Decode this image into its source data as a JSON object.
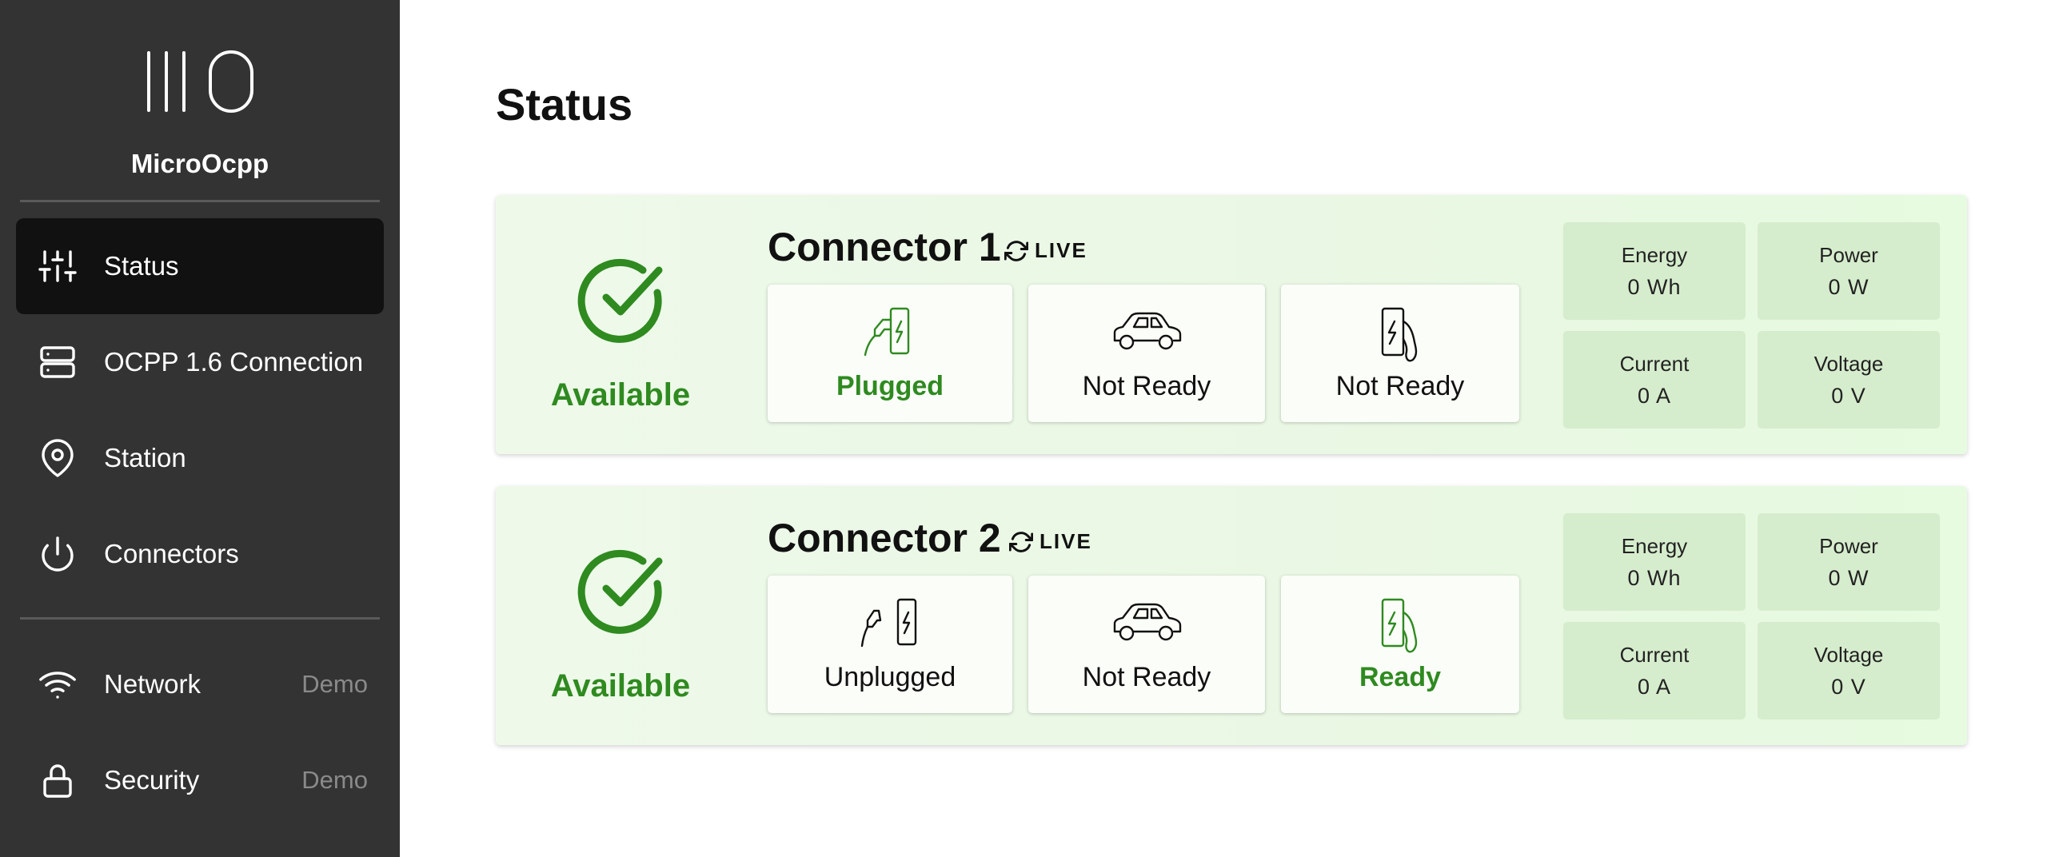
{
  "app": {
    "brand": "MicroOcpp",
    "logo_icon": "microocpp-logo"
  },
  "sidebar": {
    "items": [
      {
        "label": "Status",
        "icon": "sliders-icon",
        "badge": "",
        "active": true
      },
      {
        "label": "OCPP 1.6 Connection",
        "icon": "server-icon",
        "badge": ""
      },
      {
        "label": "Station",
        "icon": "map-pin-icon",
        "badge": ""
      },
      {
        "label": "Connectors",
        "icon": "power-icon",
        "badge": ""
      },
      {
        "label": "Network",
        "icon": "wifi-icon",
        "badge": "Demo"
      },
      {
        "label": "Security",
        "icon": "lock-icon",
        "badge": "Demo"
      }
    ]
  },
  "page": {
    "title": "Status"
  },
  "connectors": [
    {
      "title": "Connector 1",
      "live": "LIVE",
      "status": "Available",
      "tiles": [
        {
          "label": "Plugged",
          "icon": "plug-connected-icon",
          "active": true
        },
        {
          "label": "Not Ready",
          "icon": "car-icon",
          "active": false
        },
        {
          "label": "Not Ready",
          "icon": "charger-icon",
          "active": false
        }
      ],
      "metrics": [
        {
          "name": "Energy",
          "value": "0 Wh"
        },
        {
          "name": "Power",
          "value": "0 W"
        },
        {
          "name": "Current",
          "value": "0 A"
        },
        {
          "name": "Voltage",
          "value": "0 V"
        }
      ]
    },
    {
      "title": "Connector 2",
      "live": "LIVE",
      "status": "Available",
      "tiles": [
        {
          "label": "Unplugged",
          "icon": "plug-disconnected-icon",
          "active": false
        },
        {
          "label": "Not Ready",
          "icon": "car-icon",
          "active": false
        },
        {
          "label": "Ready",
          "icon": "charger-icon",
          "active": true
        }
      ],
      "metrics": [
        {
          "name": "Energy",
          "value": "0 Wh"
        },
        {
          "name": "Power",
          "value": "0 W"
        },
        {
          "name": "Current",
          "value": "0 A"
        },
        {
          "name": "Voltage",
          "value": "0 V"
        }
      ]
    }
  ],
  "colors": {
    "sidebar": "#333333",
    "active_nav": "#111111",
    "accent_green": "#2f8a20",
    "card_bg": "#eef9ea",
    "metric_bg": "#d6edcd"
  }
}
